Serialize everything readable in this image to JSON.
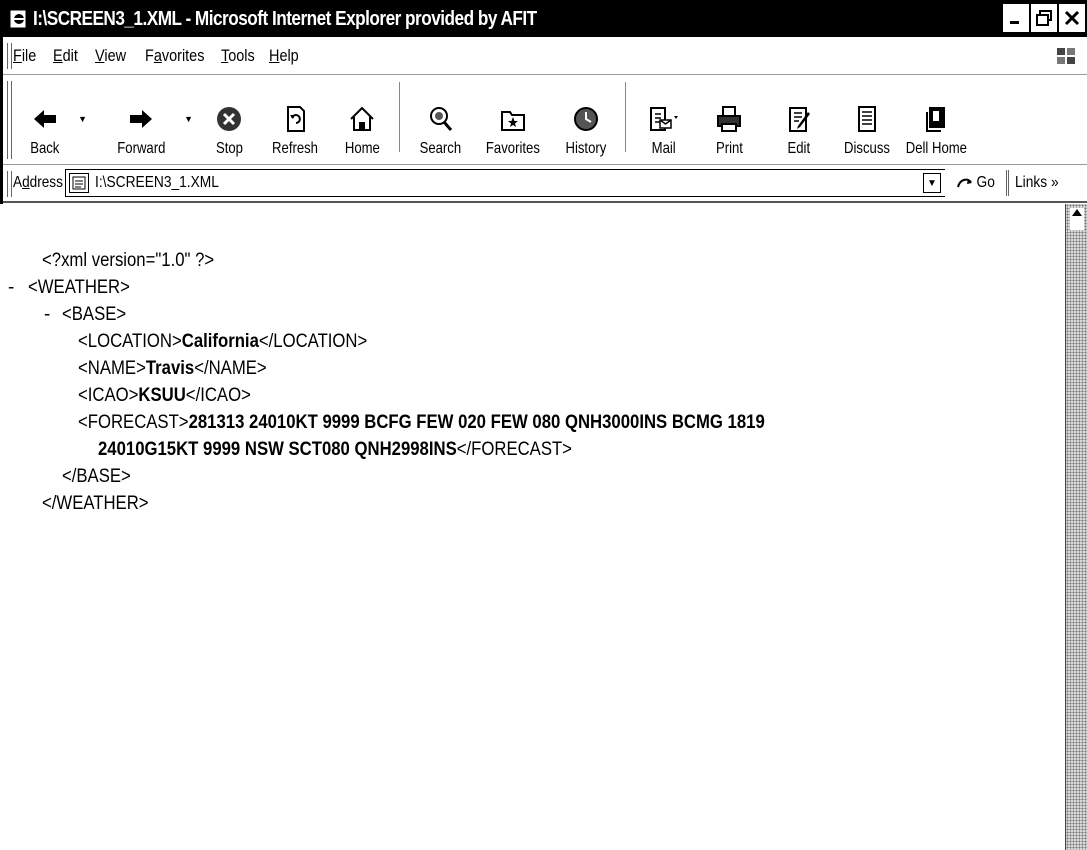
{
  "window": {
    "title": "I:\\SCREEN3_1.XML - Microsoft Internet Explorer provided by AFIT",
    "controls": [
      "_",
      "Ơ",
      "X"
    ]
  },
  "menu": [
    {
      "label": "File",
      "accel": "F",
      "rest": "ile"
    },
    {
      "label": "Edit",
      "accel": "E",
      "rest": "dit"
    },
    {
      "label": "View",
      "accel": "V",
      "rest": "iew"
    },
    {
      "label": "Favorites",
      "pre": "F",
      "accel": "a",
      "rest": "vorites"
    },
    {
      "label": "Tools",
      "accel": "T",
      "rest": "ools"
    },
    {
      "label": "Help",
      "accel": "H",
      "rest": "elp"
    }
  ],
  "toolbar": {
    "back": "Back",
    "forward": "Forward",
    "stop": "Stop",
    "refresh": "Refresh",
    "home": "Home",
    "search": "Search",
    "favorites": "Favorites",
    "history": "History",
    "mail": "Mail",
    "print": "Print",
    "edit": "Edit",
    "discuss": "Discuss",
    "dell_home": "Dell Home"
  },
  "address": {
    "label": "Address",
    "value": "I:\\SCREEN3_1.XML",
    "go": "Go",
    "links": "Links »"
  },
  "xml": {
    "decl": "<?xml version=\"1.0\" ?>",
    "minus": "-",
    "weather_open": "<WEATHER>",
    "base_open": "<BASE>",
    "location_open": "<LOCATION>",
    "location_value": "California",
    "location_close": "</LOCATION>",
    "name_open": "<NAME>",
    "name_value": "Travis",
    "name_close": "</NAME>",
    "icao_open": "<ICAO>",
    "icao_value": "KSUU",
    "icao_close": "</ICAO>",
    "forecast_open": "<FORECAST>",
    "forecast_line1": "281313 24010KT 9999 BCFG FEW 020 FEW 080 QNH3000INS BCMG 1819",
    "forecast_line2": "24010G15KT 9999 NSW SCT080 QNH2998INS",
    "forecast_close": "</FORECAST>",
    "base_close": "</BASE>",
    "weather_close": "</WEATHER>"
  }
}
